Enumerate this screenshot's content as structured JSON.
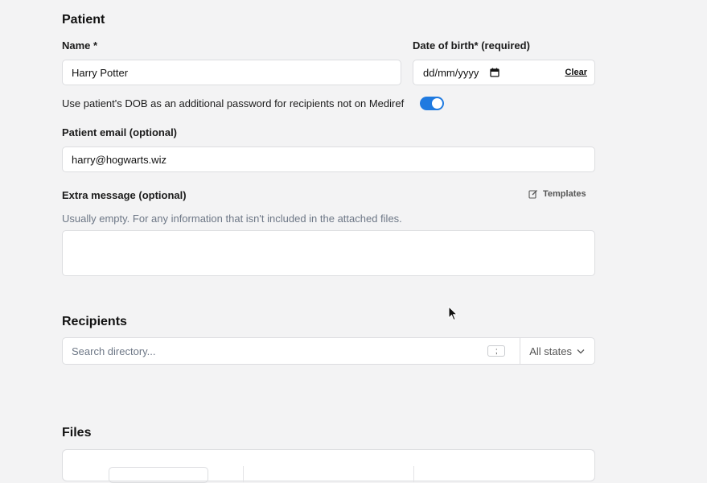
{
  "patient": {
    "section_title": "Patient",
    "name_label": "Name *",
    "name_value": "Harry Potter",
    "dob_label": "Date of birth* (required)",
    "dob_placeholder": "dd/mm/yyyy",
    "dob_clear": "Clear",
    "dob_password_text": "Use patient's DOB as an additional password for recipients not on Mediref",
    "dob_password_enabled": true,
    "email_label": "Patient email (optional)",
    "email_value": "harry@hogwarts.wiz",
    "extra_label": "Extra message (optional)",
    "templates_label": "Templates",
    "extra_hint": "Usually empty. For any information that isn't included in the attached files.",
    "extra_value": ""
  },
  "recipients": {
    "section_title": "Recipients",
    "search_placeholder": "Search directory...",
    "shortcut_key": ";",
    "state_filter": "All states"
  },
  "files": {
    "section_title": "Files"
  },
  "colors": {
    "accent": "#1f7ae0",
    "background": "#f3f3f4"
  }
}
